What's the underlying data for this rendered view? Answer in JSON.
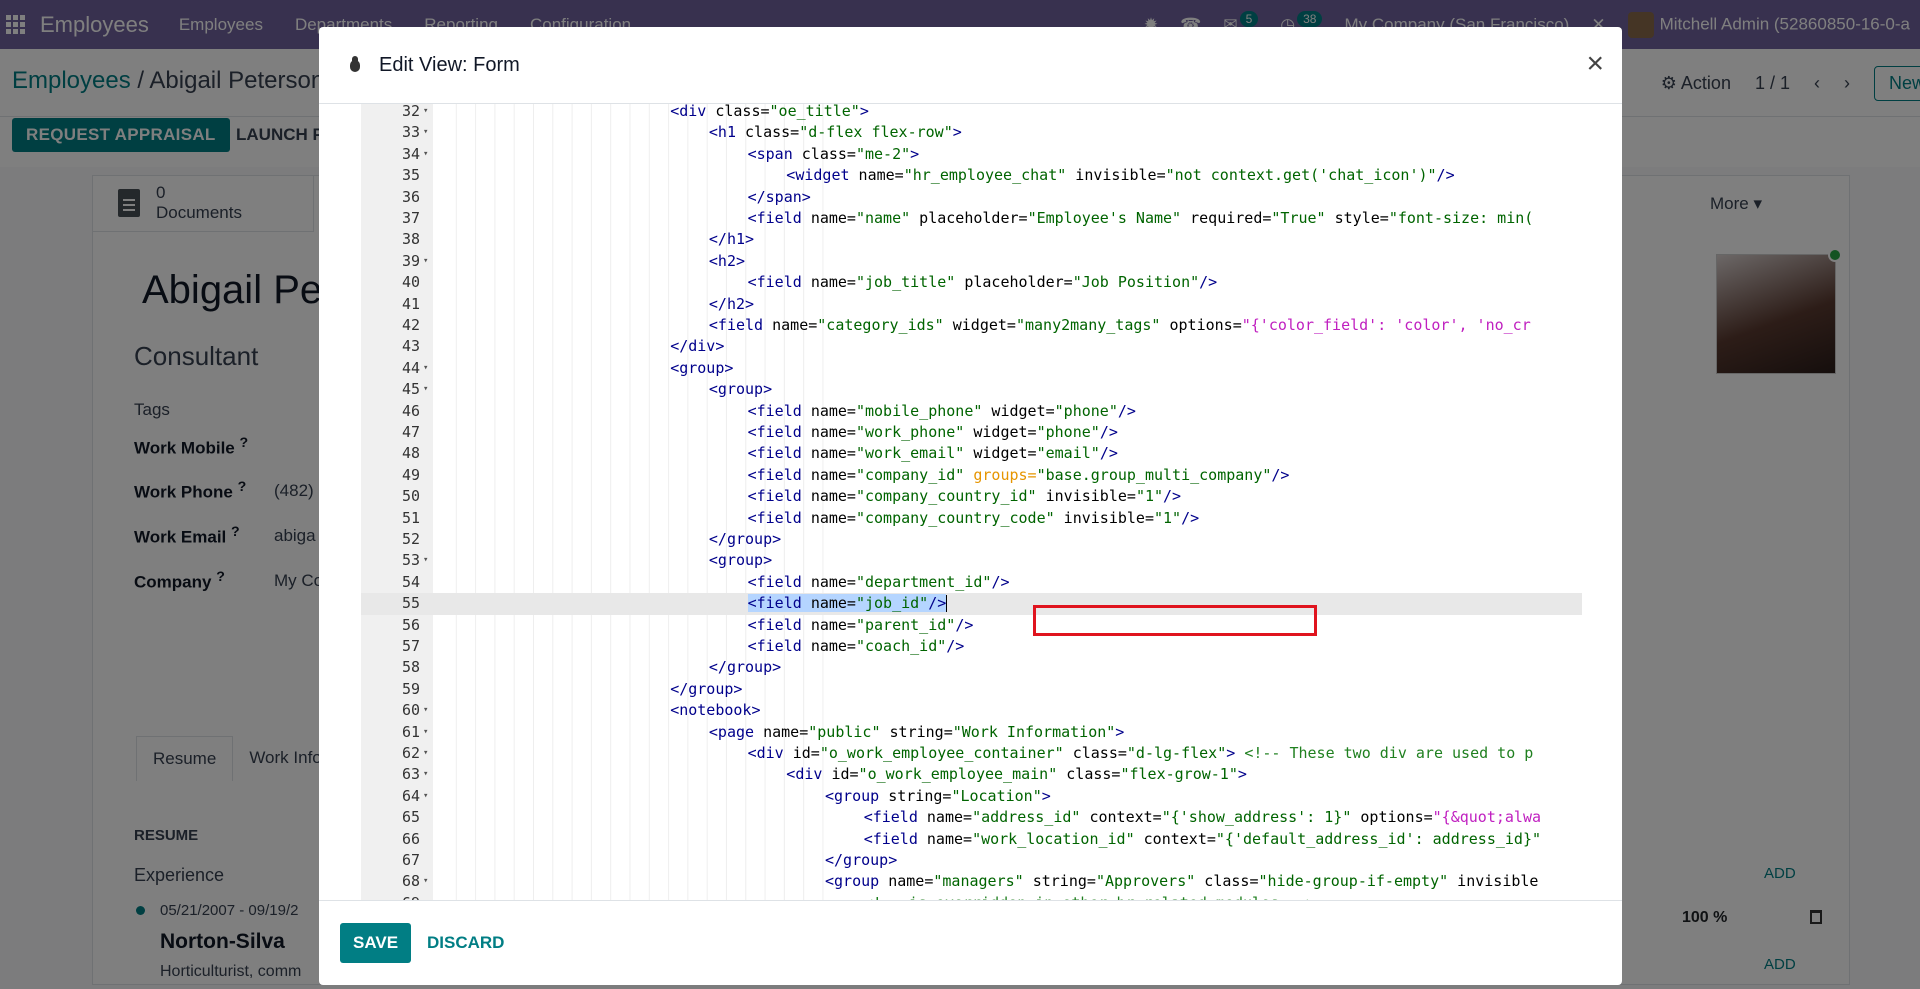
{
  "topbar": {
    "app_title": "Employees",
    "menu": [
      "Employees",
      "Departments",
      "Reporting",
      "Configuration"
    ],
    "chat_count": "5",
    "activity_count": "38",
    "company": "My Company (San Francisco)",
    "user": "Mitchell Admin (52860850-16-0-a"
  },
  "breadcrumb": {
    "parent": "Employees",
    "separator": "/",
    "current": "Abigail Peterson"
  },
  "actions": {
    "action_label": "Action",
    "pager": "1 / 1",
    "new_label": "New"
  },
  "status_buttons": {
    "request_appraisal": "REQUEST APPRAISAL",
    "launch_plan": "LAUNCH P"
  },
  "smart_button": {
    "count": "0",
    "label": "Documents"
  },
  "more_label": "More",
  "employee": {
    "name": "Abigail Pe",
    "job": "Consultant",
    "tags_label": "Tags",
    "work_mobile_label": "Work Mobile",
    "work_phone_label": "Work Phone",
    "work_phone_value": "(482)",
    "work_email_label": "Work Email",
    "work_email_value": "abiga",
    "company_label": "Company",
    "company_value": "My Co",
    "help_mark": "?"
  },
  "tabs": [
    "Resume",
    "Work Info"
  ],
  "resume": {
    "heading": "RESUME",
    "experience": "Experience",
    "add_label": "ADD",
    "entry_dates": "05/21/2007 - 09/19/2",
    "entry_company": "Norton-Silva",
    "entry_desc": "Horticulturist, comm",
    "skill_pct": "100 %"
  },
  "modal": {
    "title": "Edit View: Form",
    "close": "×",
    "save_label": "SAVE",
    "discard_label": "DISCARD",
    "active_line": 55,
    "lines": [
      {
        "n": 32,
        "fold": true,
        "indent": 6,
        "tokens": [
          [
            "tag",
            "<div "
          ],
          [
            "attr",
            "class="
          ],
          [
            "str",
            "\"oe_title\""
          ],
          [
            "tag",
            ">"
          ]
        ]
      },
      {
        "n": 33,
        "fold": true,
        "indent": 7,
        "tokens": [
          [
            "tag",
            "<h1 "
          ],
          [
            "attr",
            "class="
          ],
          [
            "str",
            "\"d-flex flex-row\""
          ],
          [
            "tag",
            ">"
          ]
        ]
      },
      {
        "n": 34,
        "fold": true,
        "indent": 8,
        "tokens": [
          [
            "tag",
            "<span "
          ],
          [
            "attr",
            "class="
          ],
          [
            "str",
            "\"me-2\""
          ],
          [
            "tag",
            ">"
          ]
        ]
      },
      {
        "n": 35,
        "fold": false,
        "indent": 9,
        "tokens": [
          [
            "tag",
            "<widget "
          ],
          [
            "attr",
            "name="
          ],
          [
            "str",
            "\"hr_employee_chat\""
          ],
          [
            "attr",
            " invisible="
          ],
          [
            "str",
            "\"not context.get('chat_icon')\""
          ],
          [
            "tag",
            "/>"
          ]
        ]
      },
      {
        "n": 36,
        "fold": false,
        "indent": 8,
        "tokens": [
          [
            "tag",
            "</span>"
          ]
        ]
      },
      {
        "n": 37,
        "fold": false,
        "indent": 8,
        "tokens": [
          [
            "tag",
            "<field "
          ],
          [
            "attr",
            "name="
          ],
          [
            "str",
            "\"name\""
          ],
          [
            "attr",
            " placeholder="
          ],
          [
            "str",
            "\"Employee's Name\""
          ],
          [
            "attr",
            " required="
          ],
          [
            "str",
            "\"True\""
          ],
          [
            "attr",
            " style="
          ],
          [
            "str",
            "\"font-size: min("
          ]
        ]
      },
      {
        "n": 38,
        "fold": false,
        "indent": 7,
        "tokens": [
          [
            "tag",
            "</h1>"
          ]
        ]
      },
      {
        "n": 39,
        "fold": true,
        "indent": 7,
        "tokens": [
          [
            "tag",
            "<h2>"
          ]
        ]
      },
      {
        "n": 40,
        "fold": false,
        "indent": 8,
        "tokens": [
          [
            "tag",
            "<field "
          ],
          [
            "attr",
            "name="
          ],
          [
            "str",
            "\"job_title\""
          ],
          [
            "attr",
            " placeholder="
          ],
          [
            "str",
            "\"Job Position\""
          ],
          [
            "tag",
            "/>"
          ]
        ]
      },
      {
        "n": 41,
        "fold": false,
        "indent": 7,
        "tokens": [
          [
            "tag",
            "</h2>"
          ]
        ]
      },
      {
        "n": 42,
        "fold": false,
        "indent": 7,
        "tokens": [
          [
            "tag",
            "<field "
          ],
          [
            "attr",
            "name="
          ],
          [
            "str",
            "\"category_ids\""
          ],
          [
            "attr",
            " widget="
          ],
          [
            "str",
            "\"many2many_tags\""
          ],
          [
            "attr",
            " options="
          ],
          [
            "str2",
            "\"{'color_field': 'color', 'no_cr"
          ]
        ]
      },
      {
        "n": 43,
        "fold": false,
        "indent": 6,
        "tokens": [
          [
            "tag",
            "</div>"
          ]
        ]
      },
      {
        "n": 44,
        "fold": true,
        "indent": 6,
        "tokens": [
          [
            "tag",
            "<group>"
          ]
        ]
      },
      {
        "n": 45,
        "fold": true,
        "indent": 7,
        "tokens": [
          [
            "tag",
            "<group>"
          ]
        ]
      },
      {
        "n": 46,
        "fold": false,
        "indent": 8,
        "tokens": [
          [
            "tag",
            "<field "
          ],
          [
            "attr",
            "name="
          ],
          [
            "str",
            "\"mobile_phone\""
          ],
          [
            "attr",
            " widget="
          ],
          [
            "str",
            "\"phone\""
          ],
          [
            "tag",
            "/>"
          ]
        ]
      },
      {
        "n": 47,
        "fold": false,
        "indent": 8,
        "tokens": [
          [
            "tag",
            "<field "
          ],
          [
            "attr",
            "name="
          ],
          [
            "str",
            "\"work_phone\""
          ],
          [
            "attr",
            " widget="
          ],
          [
            "str",
            "\"phone\""
          ],
          [
            "tag",
            "/>"
          ]
        ]
      },
      {
        "n": 48,
        "fold": false,
        "indent": 8,
        "tokens": [
          [
            "tag",
            "<field "
          ],
          [
            "attr",
            "name="
          ],
          [
            "str",
            "\"work_email\""
          ],
          [
            "attr",
            " widget="
          ],
          [
            "str",
            "\"email\""
          ],
          [
            "tag",
            "/>"
          ]
        ]
      },
      {
        "n": 49,
        "fold": false,
        "indent": 8,
        "tokens": [
          [
            "tag",
            "<field "
          ],
          [
            "attr",
            "name="
          ],
          [
            "str",
            "\"company_id\""
          ],
          [
            "grp",
            " groups="
          ],
          [
            "str",
            "\"base.group_multi_company\""
          ],
          [
            "tag",
            "/>"
          ]
        ]
      },
      {
        "n": 50,
        "fold": false,
        "indent": 8,
        "tokens": [
          [
            "tag",
            "<field "
          ],
          [
            "attr",
            "name="
          ],
          [
            "str",
            "\"company_country_id\""
          ],
          [
            "attr",
            " invisible="
          ],
          [
            "str",
            "\"1\""
          ],
          [
            "tag",
            "/>"
          ]
        ]
      },
      {
        "n": 51,
        "fold": false,
        "indent": 8,
        "tokens": [
          [
            "tag",
            "<field "
          ],
          [
            "attr",
            "name="
          ],
          [
            "str",
            "\"company_country_code\""
          ],
          [
            "attr",
            " invisible="
          ],
          [
            "str",
            "\"1\""
          ],
          [
            "tag",
            "/>"
          ]
        ]
      },
      {
        "n": 52,
        "fold": false,
        "indent": 7,
        "tokens": [
          [
            "tag",
            "</group>"
          ]
        ]
      },
      {
        "n": 53,
        "fold": true,
        "indent": 7,
        "tokens": [
          [
            "tag",
            "<group>"
          ]
        ]
      },
      {
        "n": 54,
        "fold": false,
        "indent": 8,
        "tokens": [
          [
            "tag",
            "<field "
          ],
          [
            "attr",
            "name="
          ],
          [
            "str",
            "\"department_id\""
          ],
          [
            "tag",
            "/>"
          ]
        ]
      },
      {
        "n": 55,
        "fold": false,
        "indent": 8,
        "selected": true,
        "tokens": [
          [
            "tag",
            "<field "
          ],
          [
            "attr",
            "name="
          ],
          [
            "str",
            "\"job_id\""
          ],
          [
            "tag",
            "/>"
          ]
        ]
      },
      {
        "n": 56,
        "fold": false,
        "indent": 8,
        "tokens": [
          [
            "tag",
            "<field "
          ],
          [
            "attr",
            "name="
          ],
          [
            "str",
            "\"parent_id\""
          ],
          [
            "tag",
            "/>"
          ]
        ]
      },
      {
        "n": 57,
        "fold": false,
        "indent": 8,
        "tokens": [
          [
            "tag",
            "<field "
          ],
          [
            "attr",
            "name="
          ],
          [
            "str",
            "\"coach_id\""
          ],
          [
            "tag",
            "/>"
          ]
        ]
      },
      {
        "n": 58,
        "fold": false,
        "indent": 7,
        "tokens": [
          [
            "tag",
            "</group>"
          ]
        ]
      },
      {
        "n": 59,
        "fold": false,
        "indent": 6,
        "tokens": [
          [
            "tag",
            "</group>"
          ]
        ]
      },
      {
        "n": 60,
        "fold": true,
        "indent": 6,
        "tokens": [
          [
            "tag",
            "<notebook>"
          ]
        ]
      },
      {
        "n": 61,
        "fold": true,
        "indent": 7,
        "tokens": [
          [
            "tag",
            "<page "
          ],
          [
            "attr",
            "name="
          ],
          [
            "str",
            "\"public\""
          ],
          [
            "attr",
            " string="
          ],
          [
            "str",
            "\"Work Information\""
          ],
          [
            "tag",
            ">"
          ]
        ]
      },
      {
        "n": 62,
        "fold": true,
        "indent": 8,
        "tokens": [
          [
            "tag",
            "<div "
          ],
          [
            "attr",
            "id="
          ],
          [
            "str",
            "\"o_work_employee_container\""
          ],
          [
            "attr",
            " class="
          ],
          [
            "str",
            "\"d-lg-flex\""
          ],
          [
            "tag",
            "> "
          ],
          [
            "com",
            "<!-- These two div are used to p"
          ]
        ]
      },
      {
        "n": 63,
        "fold": true,
        "indent": 9,
        "tokens": [
          [
            "tag",
            "<div "
          ],
          [
            "attr",
            "id="
          ],
          [
            "str",
            "\"o_work_employee_main\""
          ],
          [
            "attr",
            " class="
          ],
          [
            "str",
            "\"flex-grow-1\""
          ],
          [
            "tag",
            ">"
          ]
        ]
      },
      {
        "n": 64,
        "fold": true,
        "indent": 10,
        "tokens": [
          [
            "tag",
            "<group "
          ],
          [
            "attr",
            "string="
          ],
          [
            "str",
            "\"Location\""
          ],
          [
            "tag",
            ">"
          ]
        ]
      },
      {
        "n": 65,
        "fold": false,
        "indent": 11,
        "tokens": [
          [
            "tag",
            "<field "
          ],
          [
            "attr",
            "name="
          ],
          [
            "str",
            "\"address_id\""
          ],
          [
            "attr",
            " context="
          ],
          [
            "str",
            "\"{'show_address': 1}\""
          ],
          [
            "attr",
            " options="
          ],
          [
            "str2",
            "\"{&quot;alwa"
          ]
        ]
      },
      {
        "n": 66,
        "fold": false,
        "indent": 11,
        "tokens": [
          [
            "tag",
            "<field "
          ],
          [
            "attr",
            "name="
          ],
          [
            "str",
            "\"work_location_id\""
          ],
          [
            "attr",
            " context="
          ],
          [
            "str",
            "\"{'default_address_id': address_id}\""
          ]
        ]
      },
      {
        "n": 67,
        "fold": false,
        "indent": 10,
        "tokens": [
          [
            "tag",
            "</group>"
          ]
        ]
      },
      {
        "n": 68,
        "fold": true,
        "indent": 10,
        "tokens": [
          [
            "tag",
            "<group "
          ],
          [
            "attr",
            "name="
          ],
          [
            "str",
            "\"managers\""
          ],
          [
            "attr",
            " string="
          ],
          [
            "str",
            "\"Approvers\""
          ],
          [
            "attr",
            " class="
          ],
          [
            "str",
            "\"hide-group-if-empty\""
          ],
          [
            "attr",
            " invisible"
          ]
        ]
      },
      {
        "n": 69,
        "fold": false,
        "indent": 11,
        "tokens": [
          [
            "com",
            "<!-- is overridden in other hr related modules -->"
          ]
        ]
      }
    ]
  }
}
